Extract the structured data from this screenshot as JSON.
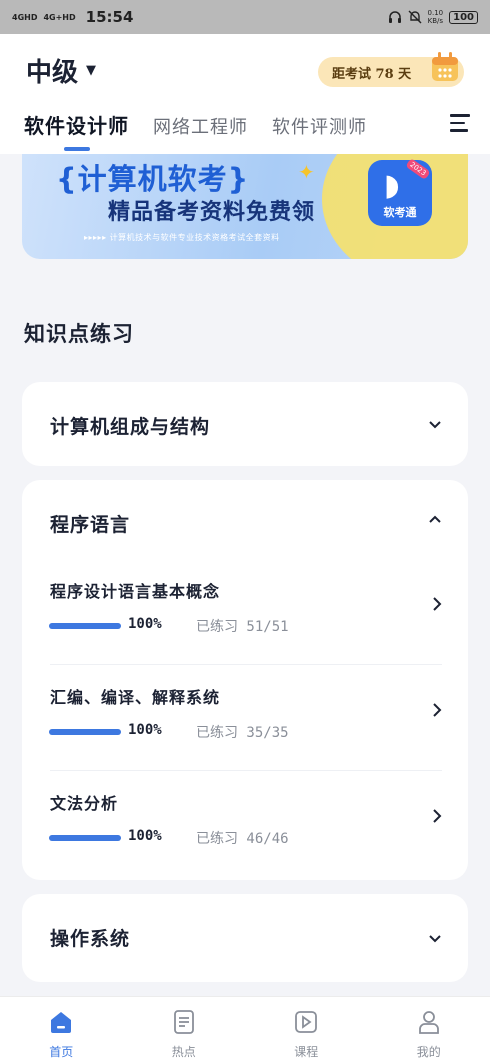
{
  "status_bar": {
    "signal_1": "4GHD",
    "signal_2": "4G+HD",
    "time": "15:54",
    "net_speed_value": "0.10",
    "net_speed_unit": "KB/s",
    "battery": "100"
  },
  "header": {
    "level": "中级",
    "countdown": "距考试 78 天",
    "tabs": [
      {
        "label": "软件设计师",
        "active": true
      },
      {
        "label": "网络工程师",
        "active": false
      },
      {
        "label": "软件评测师",
        "active": false
      }
    ]
  },
  "banner": {
    "title": "{计算机软考}",
    "subtitle": "精品备考资料免费领",
    "note": "▸▸▸▸▸ 计算机技术与软件专业技术资格考试全套资料",
    "app_name": "软考通",
    "year": "2023"
  },
  "main": {
    "section_title": "知识点练习",
    "categories": [
      {
        "name": "计算机组成与结构",
        "expanded": false
      },
      {
        "name": "程序语言",
        "expanded": true,
        "items": [
          {
            "title": "程序设计语言基本概念",
            "percent_label": "100%",
            "progress": 1.0,
            "done": "已练习 51/51"
          },
          {
            "title": "汇编、编译、解释系统",
            "percent_label": "100%",
            "progress": 1.0,
            "done": "已练习 35/35"
          },
          {
            "title": "文法分析",
            "percent_label": "100%",
            "progress": 1.0,
            "done": "已练习 46/46"
          }
        ]
      },
      {
        "name": "操作系统",
        "expanded": false
      }
    ]
  },
  "tab_bar": {
    "items": [
      {
        "label": "首页",
        "icon": "home-icon",
        "active": true
      },
      {
        "label": "热点",
        "icon": "document-icon",
        "active": false
      },
      {
        "label": "课程",
        "icon": "play-icon",
        "active": false
      },
      {
        "label": "我的",
        "icon": "user-icon",
        "active": false
      }
    ]
  },
  "colors": {
    "accent": "#3d78e0",
    "countdown_bg": "#fbe6b8",
    "page_bg": "#f3f4f8"
  }
}
